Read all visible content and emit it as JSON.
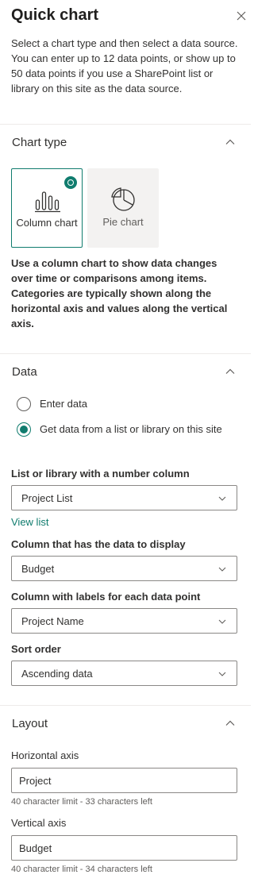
{
  "panel": {
    "title": "Quick chart",
    "description": "Select a chart type and then select a data source. You can enter up to 12 data points, or show up to 50 data points if you use a SharePoint list or library on this site as the data source."
  },
  "chart_type": {
    "section_title": "Chart type",
    "options": [
      {
        "label": "Column chart",
        "icon": "column-chart-icon",
        "selected": true
      },
      {
        "label": "Pie chart",
        "icon": "pie-chart-icon",
        "selected": false
      }
    ],
    "help_text": "Use a column chart to show data changes over time or comparisons among items. Categories are typically shown along the horizontal axis and values along the vertical axis."
  },
  "data": {
    "section_title": "Data",
    "radio_enter": "Enter data",
    "radio_list": "Get data from a list or library on this site",
    "selected_source": "list",
    "list_label": "List or library with a number column",
    "list_value": "Project List",
    "view_list_link": "View list",
    "column_data_label": "Column that has the data to display",
    "column_data_value": "Budget",
    "column_labels_label": "Column with labels for each data point",
    "column_labels_value": "Project Name",
    "sort_label": "Sort order",
    "sort_value": "Ascending data"
  },
  "layout": {
    "section_title": "Layout",
    "horizontal_label": "Horizontal axis",
    "horizontal_value": "Project",
    "horizontal_hint": "40 character limit - 33 characters left",
    "vertical_label": "Vertical axis",
    "vertical_value": "Budget",
    "vertical_hint": "40 character limit - 34 characters left"
  },
  "colors": {
    "accent": "#107c6e",
    "border": "#8a8886",
    "divider": "#edebe9"
  }
}
